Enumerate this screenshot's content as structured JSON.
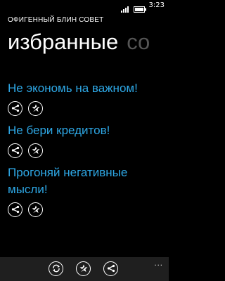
{
  "status_bar": {
    "time": "3:23",
    "icons": [
      "signal-icon",
      "battery-icon"
    ]
  },
  "app": {
    "title": "ОФИГЕННЫЙ БЛИН СОВЕТ"
  },
  "pivot": {
    "active": "избранные",
    "next_peek": "со"
  },
  "tips": [
    {
      "text": "Не экономь на важном!"
    },
    {
      "text": "Не бери кредитов!"
    },
    {
      "text": "Прогоняй негативные мысли!"
    }
  ],
  "app_bar": {
    "buttons": [
      "refresh-icon",
      "favorite-icon",
      "share-icon"
    ],
    "more_label": "..."
  }
}
